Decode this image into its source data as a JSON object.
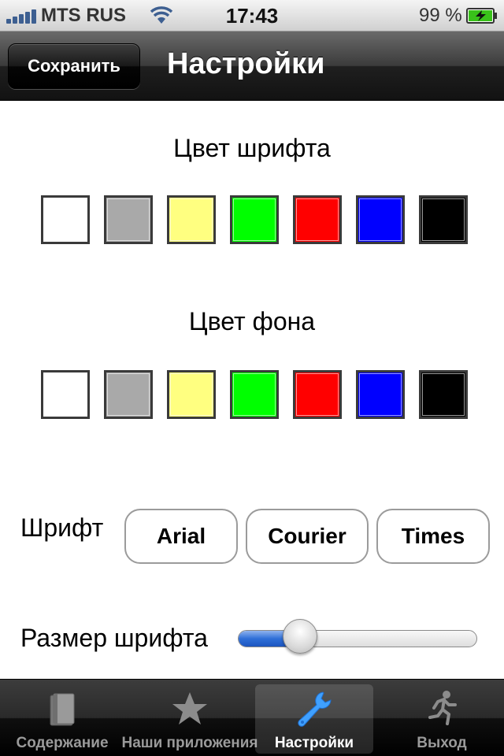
{
  "status_bar": {
    "carrier": "MTS RUS",
    "time": "17:43",
    "battery": "99 %",
    "icons": [
      "signal-bars-icon",
      "wifi-icon",
      "battery-charging-icon"
    ]
  },
  "nav": {
    "save_label": "Сохранить",
    "title": "Настройки"
  },
  "font_color": {
    "heading": "Цвет шрифта",
    "swatches": [
      "#ffffff",
      "#a9a9a9",
      "#ffff80",
      "#00ff00",
      "#ff0000",
      "#0000ff",
      "#000000"
    ]
  },
  "background_color": {
    "heading": "Цвет фона",
    "swatches": [
      "#ffffff",
      "#a9a9a9",
      "#ffff80",
      "#00ff00",
      "#ff0000",
      "#0000ff",
      "#000000"
    ]
  },
  "font": {
    "label": "Шрифт",
    "options": [
      "Arial",
      "Courier",
      "Times"
    ]
  },
  "font_size": {
    "label": "Размер шрифта",
    "value_fraction": 0.24
  },
  "tabs": [
    {
      "label": "Содержание",
      "icon": "book-icon",
      "selected": false
    },
    {
      "label": "Наши приложения",
      "icon": "star-icon",
      "selected": false
    },
    {
      "label": "Настройки",
      "icon": "wrench-icon",
      "selected": true
    },
    {
      "label": "Выход",
      "icon": "running-man-icon",
      "selected": false
    }
  ]
}
